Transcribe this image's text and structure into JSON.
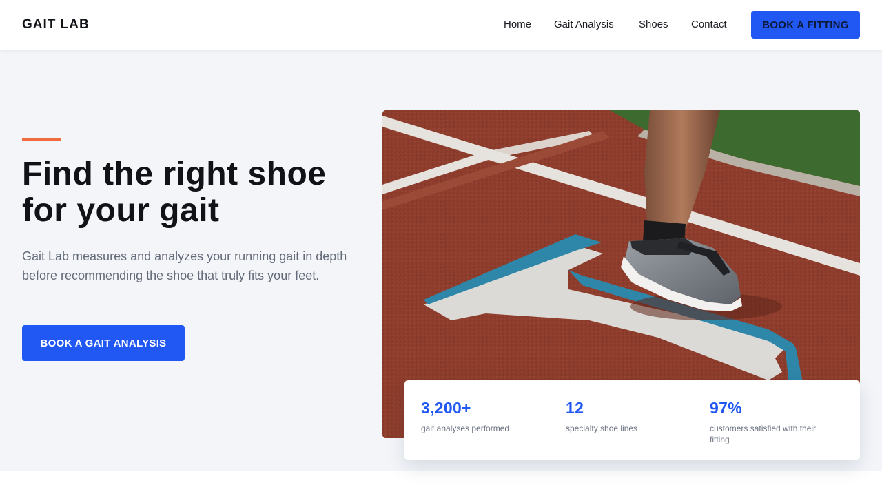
{
  "brand": {
    "logo": "GAIT LAB",
    "accent_color": "#2158f3",
    "highlight_color": "#f26a3d"
  },
  "nav": {
    "items": [
      {
        "label": "Home"
      },
      {
        "label": "Gait Analysis"
      },
      {
        "label": "Shoes"
      },
      {
        "label": "Contact"
      }
    ],
    "cta_label": "BOOK A FITTING"
  },
  "hero": {
    "title": "Find the right shoe for your gait",
    "description": "Gait Lab measures and analyzes your running gait in depth before recommending the shoe that truly fits your feet.",
    "cta_label": "BOOK A GAIT ANALYSIS",
    "image_subject": "runner-shoe-on-track-photo"
  },
  "stats": [
    {
      "value": "3,200+",
      "label": "gait analyses performed"
    },
    {
      "value": "12",
      "label": "specialty shoe lines"
    },
    {
      "value": "97%",
      "label": "customers satisfied with their fitting"
    }
  ]
}
